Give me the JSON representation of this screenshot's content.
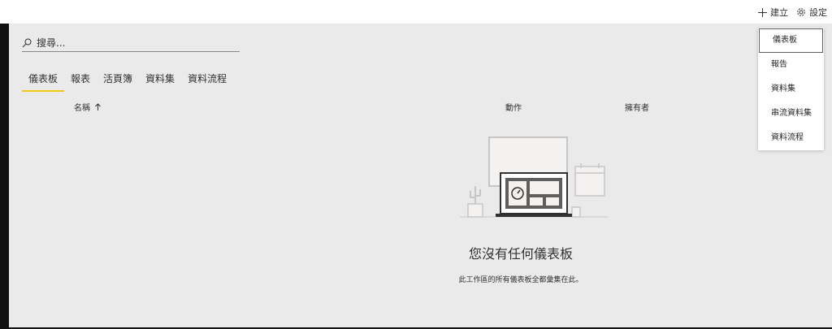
{
  "header": {
    "create_label": "建立",
    "settings_label": "設定",
    "icons": {
      "create": "plus-icon",
      "settings": "gear-icon"
    }
  },
  "search": {
    "placeholder": "搜尋..."
  },
  "tabs": [
    {
      "label": "儀表板",
      "active": true
    },
    {
      "label": "報表"
    },
    {
      "label": "活頁簿"
    },
    {
      "label": "資料集"
    },
    {
      "label": "資料流程"
    }
  ],
  "columns": {
    "name": "名稱",
    "actions": "動作",
    "owner": "擁有者",
    "sort_icon": "arrow-up-icon"
  },
  "empty_state": {
    "title": "您沒有任何儀表板",
    "subtitle": "此工作區的所有儀表板全都彙集在此。",
    "illustration": "laptop-dashboard-illustration"
  },
  "dropdown": {
    "items": [
      "儀表板",
      "報告",
      "資料集",
      "串流資料集",
      "資料流程"
    ],
    "selected_index": 0
  },
  "colors": {
    "accent_underline": "#f2c811",
    "background": "#eaeaea",
    "topbar": "#ffffff"
  }
}
